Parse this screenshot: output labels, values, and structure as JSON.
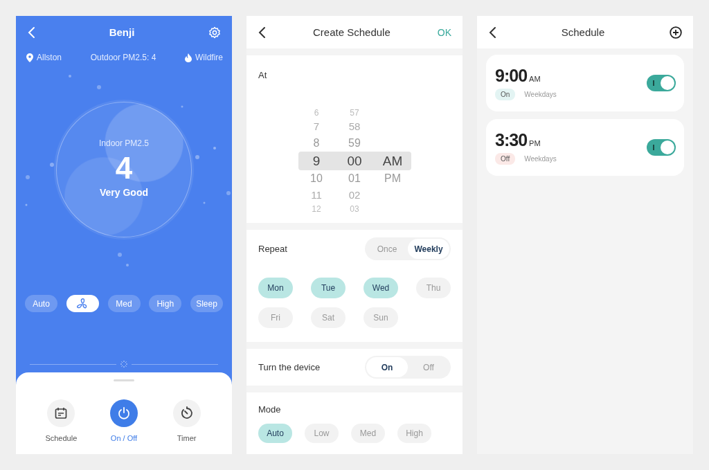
{
  "device_screen": {
    "title": "Benji",
    "location": "Allston",
    "outdoor": "Outdoor PM2.5: 4",
    "alert": "Wildfire",
    "indoor_label": "Indoor PM2.5",
    "indoor_value": "4",
    "quality": "Very Good",
    "modes": [
      {
        "kind": "text",
        "label": "Auto",
        "selected": false
      },
      {
        "kind": "fan",
        "selected": true
      },
      {
        "kind": "text",
        "label": "Med",
        "selected": false
      },
      {
        "kind": "text",
        "label": "High",
        "selected": false
      },
      {
        "kind": "text",
        "label": "Sleep",
        "selected": false
      }
    ],
    "actions": [
      {
        "kind": "schedule",
        "label": "Schedule",
        "selected": false
      },
      {
        "kind": "power",
        "label": "On / Off",
        "selected": true
      },
      {
        "kind": "timer",
        "label": "Timer",
        "selected": false
      }
    ]
  },
  "create_schedule": {
    "title": "Create Schedule",
    "confirm": "OK",
    "at_label": "At",
    "picker": {
      "hours": [
        {
          "value": "6",
          "selected": false
        },
        {
          "value": "7",
          "selected": false
        },
        {
          "value": "8",
          "selected": false
        },
        {
          "value": "9",
          "selected": true
        },
        {
          "value": "10",
          "selected": false
        },
        {
          "value": "11",
          "selected": false
        },
        {
          "value": "12",
          "selected": false
        }
      ],
      "minutes": [
        {
          "value": "57",
          "selected": false
        },
        {
          "value": "58",
          "selected": false
        },
        {
          "value": "59",
          "selected": false
        },
        {
          "value": "00",
          "selected": true
        },
        {
          "value": "01",
          "selected": false
        },
        {
          "value": "02",
          "selected": false
        },
        {
          "value": "03",
          "selected": false
        }
      ],
      "periods": [
        {
          "value": "AM",
          "selected": true
        },
        {
          "value": "PM",
          "selected": false
        }
      ]
    },
    "repeat_label": "Repeat",
    "repeat_options": [
      {
        "label": "Once",
        "selected": false
      },
      {
        "label": "Weekly",
        "selected": true
      }
    ],
    "days": [
      {
        "label": "Mon",
        "selected": true
      },
      {
        "label": "Tue",
        "selected": true
      },
      {
        "label": "Wed",
        "selected": true
      },
      {
        "label": "Thu",
        "selected": false
      },
      {
        "label": "Fri",
        "selected": false
      },
      {
        "label": "Sat",
        "selected": false
      },
      {
        "label": "Sun",
        "selected": false
      }
    ],
    "turn_label": "Turn the device",
    "turn_options": [
      {
        "label": "On",
        "selected": true
      },
      {
        "label": "Off",
        "selected": false
      }
    ],
    "mode_label": "Mode",
    "modes": [
      {
        "label": "Auto",
        "selected": true
      },
      {
        "label": "Low",
        "selected": false
      },
      {
        "label": "Med",
        "selected": false
      },
      {
        "label": "High",
        "selected": false
      }
    ]
  },
  "schedule_list": {
    "title": "Schedule",
    "entries": [
      {
        "time": "9:00",
        "period": "AM",
        "action": "On",
        "color": "#e3f4f3",
        "days": "Weekdays",
        "on": true
      },
      {
        "time": "3:30",
        "period": "PM",
        "action": "Off",
        "color": "#fbe9e7",
        "days": "Weekdays",
        "on": true
      }
    ]
  }
}
